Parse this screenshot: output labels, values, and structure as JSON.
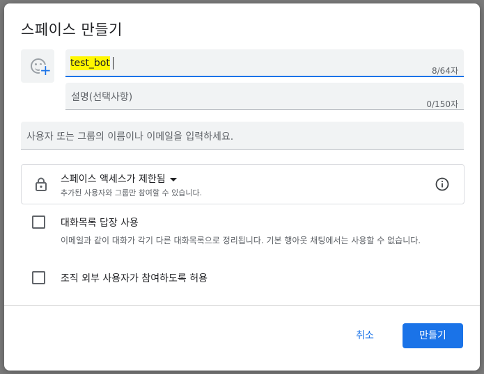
{
  "dialog": {
    "title": "스페이스 만들기",
    "name_field": {
      "value": "test_bot",
      "counter": "8/64자"
    },
    "description_field": {
      "placeholder": "설명(선택사항)",
      "counter": "0/150자"
    },
    "people_field": {
      "placeholder": "사용자 또는 그룹의 이름이나 이메일을 입력하세요."
    },
    "access": {
      "title": "스페이스 액세스가 제한됨",
      "subtitle": "추가된 사용자와 그룹만 참여할 수 있습니다."
    },
    "options": [
      {
        "label": "대화목록 답장 사용",
        "description": "이메일과 같이 대화가 각기 다른 대화목록으로 정리됩니다. 기본 행아웃 채팅에서는 사용할 수 없습니다.",
        "checked": false
      },
      {
        "label": "조직 외부 사용자가 참여하도록 허용",
        "checked": false
      }
    ],
    "buttons": {
      "cancel": "취소",
      "create": "만들기"
    }
  },
  "colors": {
    "accent": "#1a73e8",
    "highlight": "#fff700",
    "field_bg": "#f1f3f4"
  },
  "icons": [
    "emoji-add-icon",
    "lock-icon",
    "dropdown-arrow-icon",
    "info-icon"
  ]
}
